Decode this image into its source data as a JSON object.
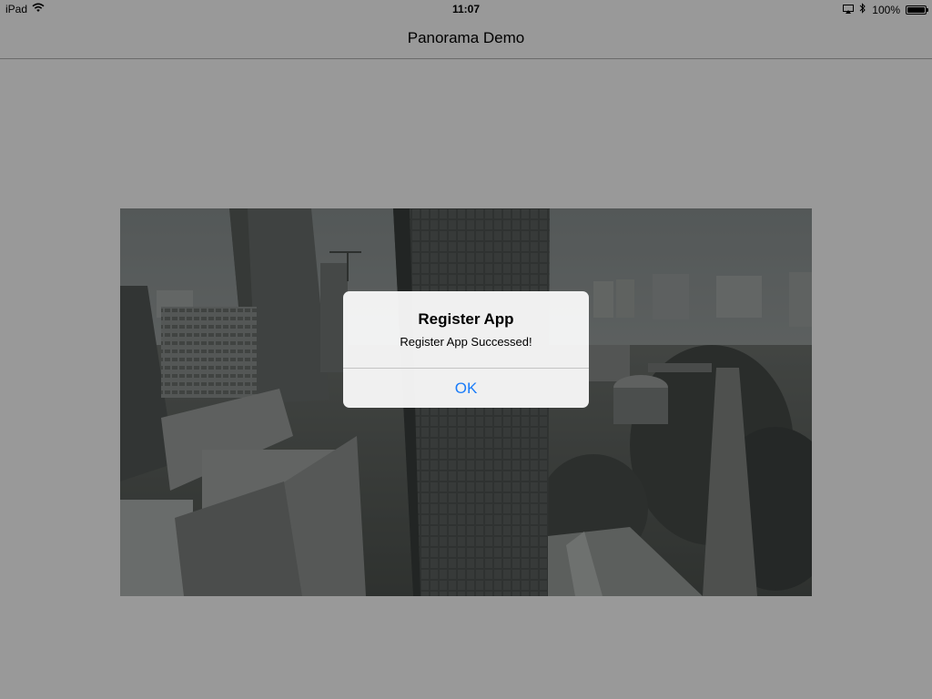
{
  "status_bar": {
    "device": "iPad",
    "time": "11:07",
    "battery": "100%",
    "battery_level": 1.0,
    "icons": [
      "wifi-icon",
      "airplay-icon",
      "bluetooth-icon",
      "battery-icon"
    ]
  },
  "nav": {
    "title": "Panorama Demo"
  },
  "panorama": {
    "content": "city-skyline-panorama"
  },
  "alert": {
    "title": "Register App",
    "message": "Register App Successed!",
    "button_label": "OK"
  },
  "colors": {
    "accent": "#1a7cf9",
    "dim_overlay": "rgba(0,0,0,0.40)",
    "alert_background": "#f8f8f8"
  }
}
